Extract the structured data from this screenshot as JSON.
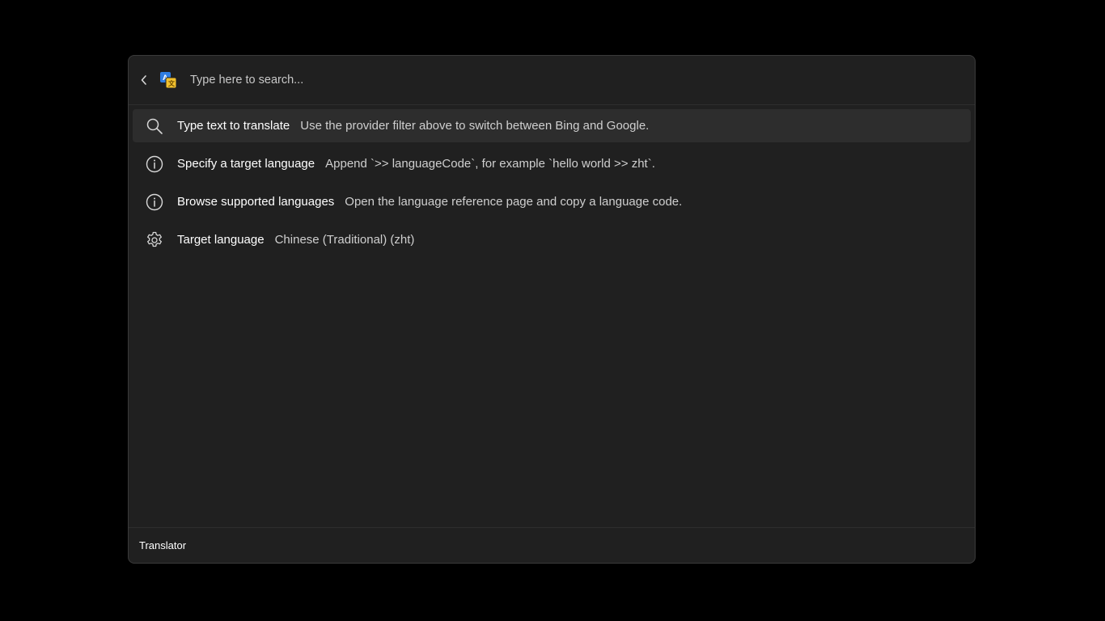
{
  "search": {
    "placeholder": "Type here to search...",
    "back_icon": "chevron-left-icon",
    "app_icon": "translator-app-icon"
  },
  "results": [
    {
      "icon": "search-icon",
      "title": "Type text to translate",
      "subtitle": "Use the provider filter above to switch between Bing and Google.",
      "selected": true
    },
    {
      "icon": "info-icon",
      "title": "Specify a target language",
      "subtitle": "Append `>> languageCode`, for example `hello world >> zht`.",
      "selected": false
    },
    {
      "icon": "info-icon",
      "title": "Browse supported languages",
      "subtitle": "Open the language reference page and copy a language code.",
      "selected": false
    },
    {
      "icon": "gear-icon",
      "title": "Target language",
      "subtitle": "Chinese (Traditional) (zht)",
      "selected": false
    }
  ],
  "footer": {
    "title": "Translator"
  },
  "colors": {
    "background": "#000000",
    "window": "#202020",
    "selected_row": "#2d2d2d",
    "app_icon_blue": "#2f7de1",
    "app_icon_yellow": "#f2c12e"
  }
}
